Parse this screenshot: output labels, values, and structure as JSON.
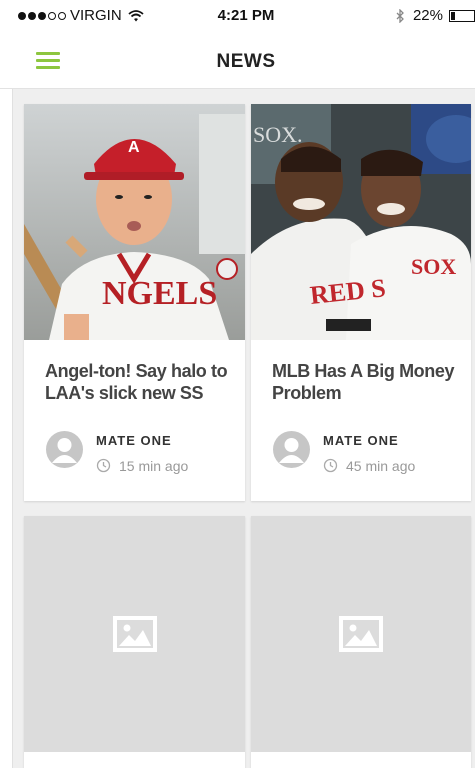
{
  "status_bar": {
    "carrier": "VIRGIN",
    "signal_strength": 3,
    "signal_max": 5,
    "time": "4:21 PM",
    "battery_percent": "22%",
    "battery_level": 0.22
  },
  "header": {
    "title": "NEWS",
    "menu_icon": "hamburger-menu-icon",
    "accent_color": "#8dc63f"
  },
  "articles": [
    {
      "title": "Angel-ton! Say halo to LAA's slick new SS",
      "author": "MATE ONE",
      "time_ago": "15 min ago",
      "image": "baseball-player-photo"
    },
    {
      "title": "MLB Has A Big Money Problem",
      "author": "MATE ONE",
      "time_ago": "45 min ago",
      "image": "two-players-dugout-photo"
    },
    {
      "image": "image-placeholder-icon"
    },
    {
      "image": "image-placeholder-icon"
    }
  ]
}
